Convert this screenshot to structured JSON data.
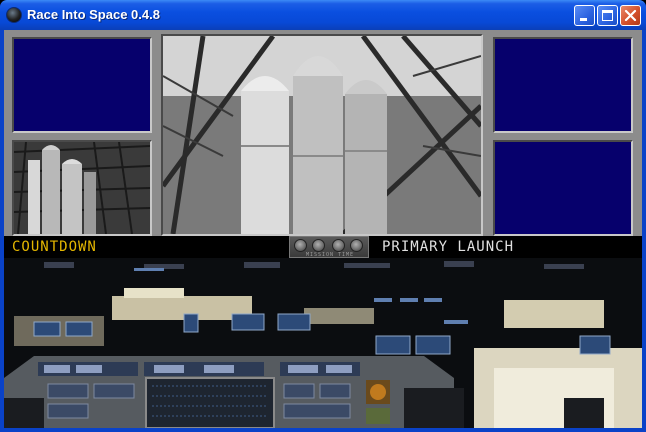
{
  "window": {
    "title": "Race Into Space 0.4.8",
    "icon": "app-icon",
    "controls": [
      "minimize-icon",
      "maximize-icon",
      "close-icon"
    ]
  },
  "game": {
    "status_label": "COUNTDOWN",
    "phase_label": "PRIMARY LAUNCH",
    "timer_caption": "MISSION TIME",
    "timer_dials": 4
  },
  "colors": {
    "titlebar": "#0a4fe0",
    "panel_gray": "#8c8c8c",
    "monitor_blue": "#06006c",
    "countdown_yellow": "#e5b700",
    "phase_white": "#e0e0e0"
  }
}
